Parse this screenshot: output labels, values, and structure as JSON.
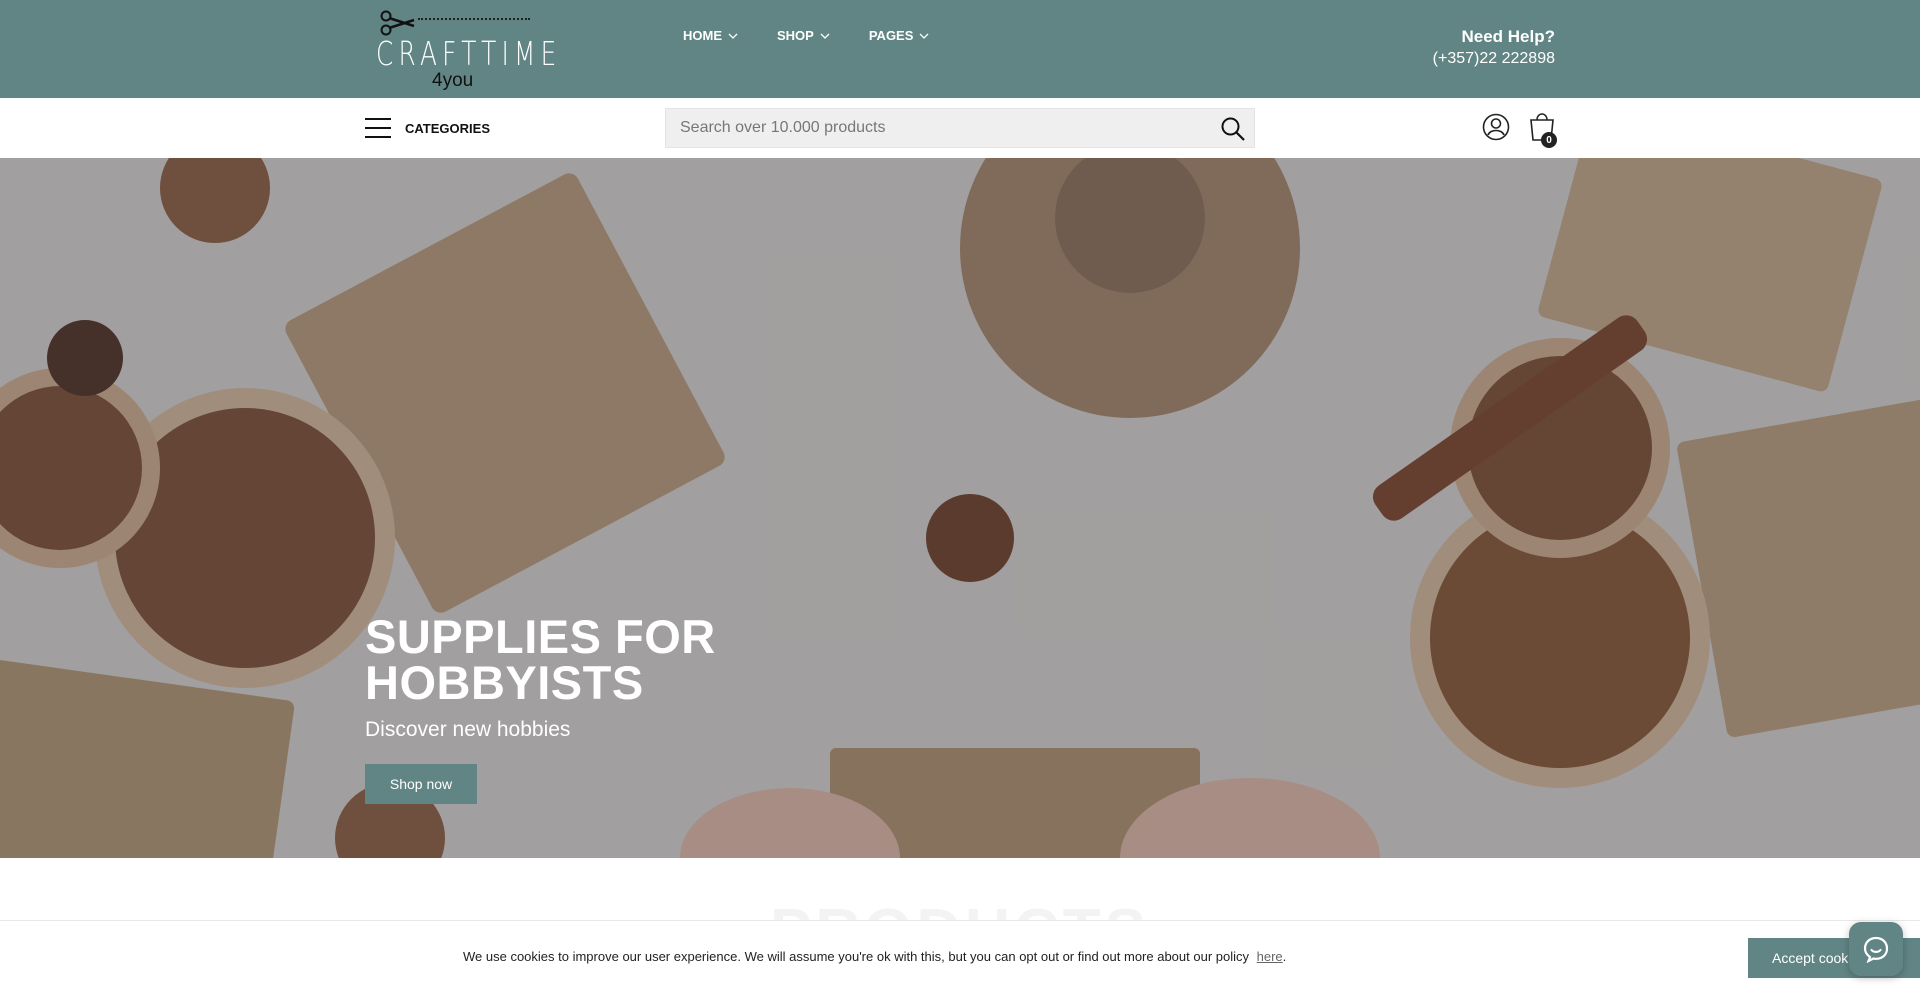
{
  "logo": {
    "brand": "CRAFTTIME",
    "sub": "4you"
  },
  "nav": [
    {
      "label": "HOME"
    },
    {
      "label": "SHOP"
    },
    {
      "label": "PAGES"
    }
  ],
  "help": {
    "title": "Need Help?",
    "phone": "(+357)22 222898"
  },
  "categories": {
    "label": "CATEGORIES"
  },
  "search": {
    "placeholder": "Search over 10.000 products"
  },
  "cart": {
    "count": "0"
  },
  "hero": {
    "title_line1": "SUPPLIES FOR",
    "title_line2": "HOBBYISTS",
    "subtitle": "Discover new hobbies",
    "button": "Shop now"
  },
  "section": {
    "ghost_title": "PRODUCTS"
  },
  "cookie": {
    "message": "We use cookies to improve our user experience. We will assume you're ok with this, but you can opt out or find out more about our policy",
    "link": "here",
    "period": ".",
    "accept": "Accept cook"
  },
  "colors": {
    "brand": "#618585"
  }
}
